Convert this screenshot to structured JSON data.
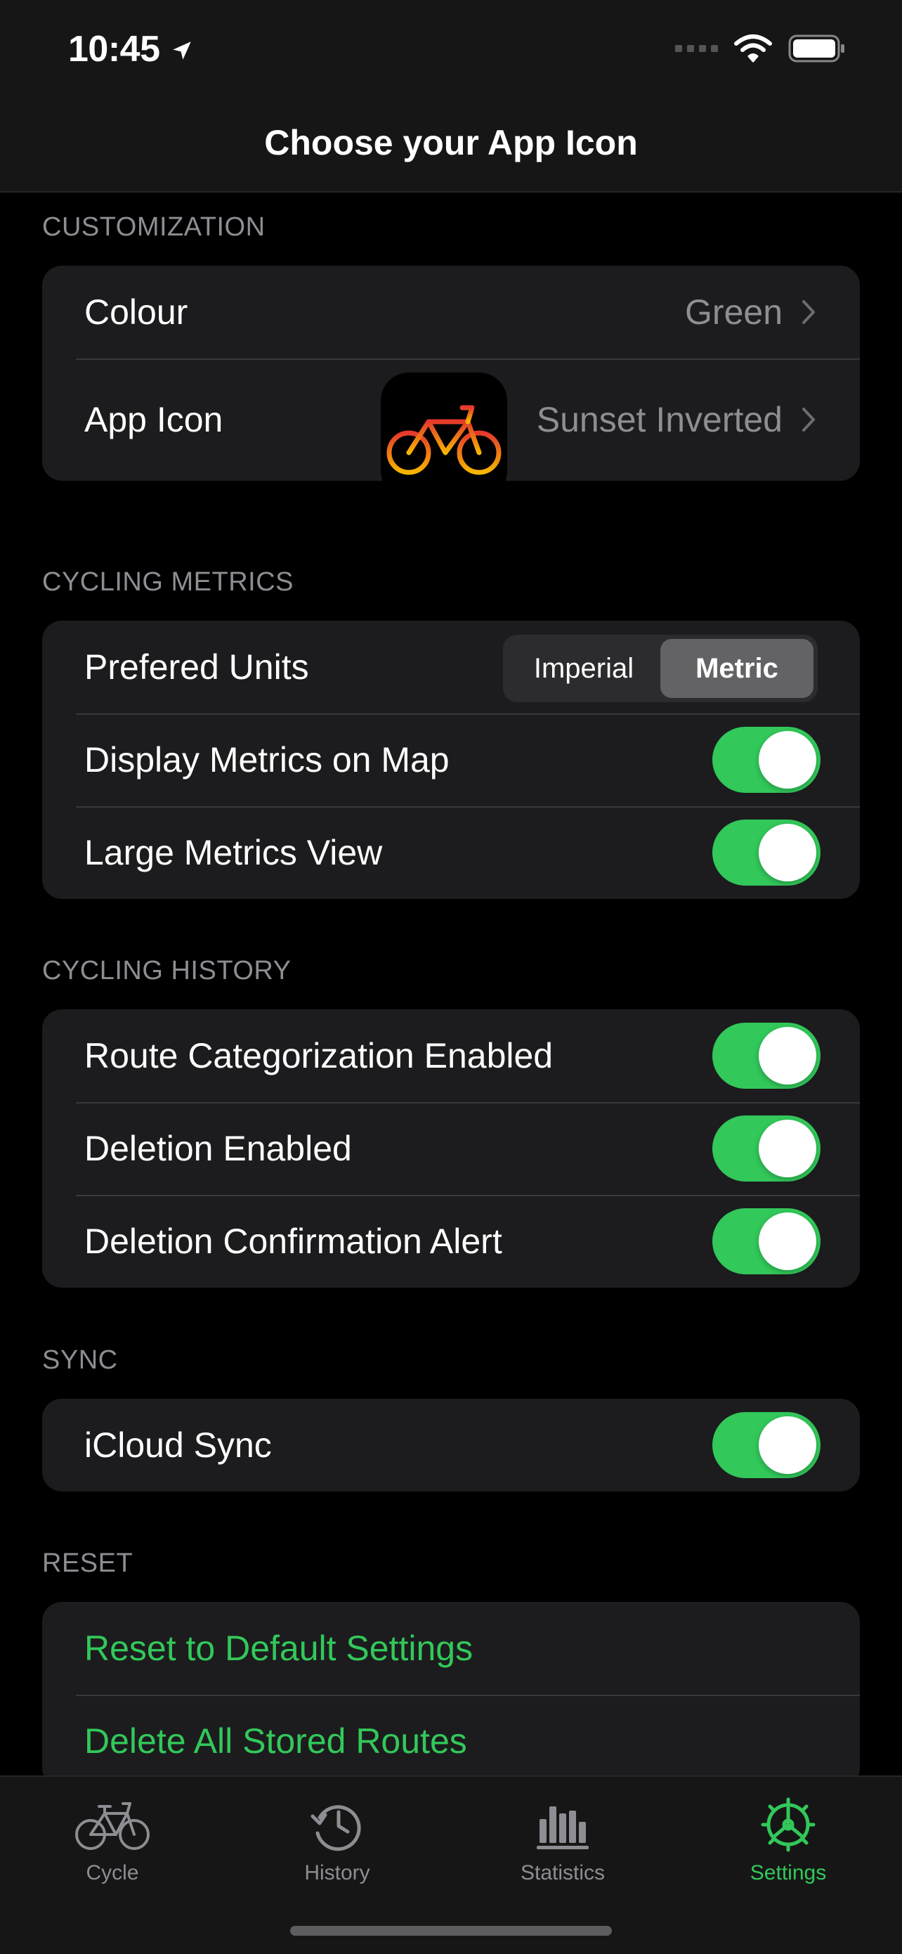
{
  "status_bar": {
    "time": "10:45"
  },
  "nav": {
    "title": "Choose your App Icon"
  },
  "customization": {
    "header": "CUSTOMIZATION",
    "colour_label": "Colour",
    "colour_value": "Green",
    "app_icon_label": "App Icon",
    "app_icon_value": "Sunset Inverted"
  },
  "cycling_metrics": {
    "header": "CYCLING METRICS",
    "units_label": "Prefered Units",
    "units_options": [
      "Imperial",
      "Metric"
    ],
    "units_selected": "Metric",
    "display_map_label": "Display Metrics on Map",
    "display_map_on": true,
    "large_view_label": "Large Metrics View",
    "large_view_on": true
  },
  "cycling_history": {
    "header": "CYCLING HISTORY",
    "route_cat_label": "Route Categorization Enabled",
    "route_cat_on": true,
    "deletion_label": "Deletion Enabled",
    "deletion_on": true,
    "deletion_alert_label": "Deletion Confirmation Alert",
    "deletion_alert_on": true
  },
  "sync": {
    "header": "SYNC",
    "icloud_label": "iCloud Sync",
    "icloud_on": true
  },
  "reset": {
    "header": "RESET",
    "reset_defaults_label": "Reset to Default Settings",
    "delete_routes_label": "Delete All Stored Routes"
  },
  "tabs": [
    {
      "label": "Cycle",
      "icon": "bicycle-icon",
      "active": false
    },
    {
      "label": "History",
      "icon": "history-icon",
      "active": false
    },
    {
      "label": "Statistics",
      "icon": "statistics-icon",
      "active": false
    },
    {
      "label": "Settings",
      "icon": "settings-gear-icon",
      "active": true
    }
  ],
  "colors": {
    "accent": "#32c85a",
    "background": "#000000",
    "cell": "#1c1c1e",
    "secondary_text": "#8d8d93"
  }
}
